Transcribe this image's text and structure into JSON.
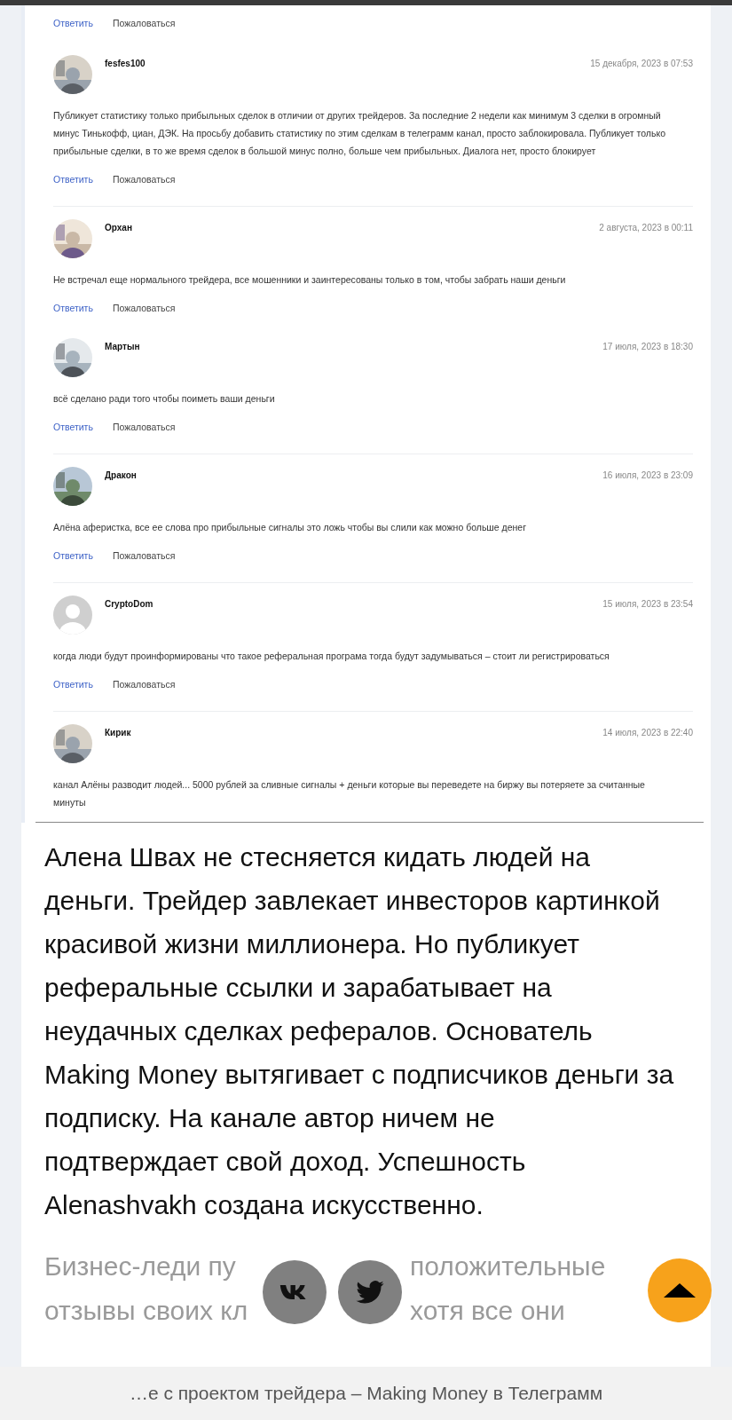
{
  "top_actions": {
    "reply": "Ответить",
    "report": "Пожаловаться"
  },
  "comments": [
    {
      "author": "fesfes100",
      "date": "15 декабря, 2023 в 07:53",
      "text": "Публикует статистику только прибыльных сделок в отличии от других трейдеров. За последние 2 недели как минимум 3 сделки в огромный минус Тинькофф, циан, ДЭК. На просьбу добавить статистику по этим сделкам в телеграмм канал, просто заблокировала. Публикует только прибыльные сделки, в то же время сделок в большой минус полно, больше чем прибыльных. Диалога нет, просто блокирует",
      "actions": {
        "reply": "Ответить",
        "report": "Пожаловаться"
      },
      "divider": true
    },
    {
      "author": "Орхан",
      "date": "2 августа, 2023 в 00:11",
      "text": "Не встречал еще нормального трейдера, все мошенники и заинтересованы только в том, чтобы забрать наши деньги",
      "actions": {
        "reply": "Ответить",
        "report": "Пожаловаться"
      },
      "divider": false
    },
    {
      "author": "Мартын",
      "date": "17 июля, 2023 в 18:30",
      "text": "всё сделано ради того чтобы поиметь ваши деньги",
      "actions": {
        "reply": "Ответить",
        "report": "Пожаловаться"
      },
      "divider": true
    },
    {
      "author": "Дракон",
      "date": "16 июля, 2023 в 23:09",
      "text": "Алёна аферистка, все ее слова про прибыльные сигналы это ложь чтобы вы слили как можно больше денег",
      "actions": {
        "reply": "Ответить",
        "report": "Пожаловаться"
      },
      "divider": true
    },
    {
      "author": "CryptoDom",
      "date": "15 июля, 2023 в 23:54",
      "avatar": {
        "kind": "default"
      },
      "text": "когда люди будут проинформированы что такое реферальная програма тогда будут задумываться – стоит ли регистрироваться",
      "actions": {
        "reply": "Ответить",
        "report": "Пожаловаться"
      },
      "divider": true
    },
    {
      "author": "Кирик",
      "date": "14 июля, 2023 в 22:40",
      "text": "канал Алёны разводит людей... 5000 рублей за сливные сигналы + деньги которые вы переведете на биржу вы потеряете за считанные минуты",
      "divider": false
    }
  ],
  "article": {
    "paragraph": "Алена Швах не стесняется кидать людей на деньги. Трейдер завлекает инвесторов картинкой красивой жизни миллионера. Но публикует реферальные ссылки и зарабатывает на неудачных сделках рефералов. Основатель Making Money вытягивает с подписчиков деньги за подписку. На канале автор ничем не подтверждает свой доход. Успешность Alenashvakh создана искусственно.",
    "faded_lines": [
      [
        "Бизнес-леди пу",
        "положительные"
      ],
      [
        "отзывы своих кл",
        "хотя все они"
      ]
    ]
  },
  "bottom_bar": {
    "text": "…е с проектом трейдера – Making Money в Телеграмм"
  }
}
